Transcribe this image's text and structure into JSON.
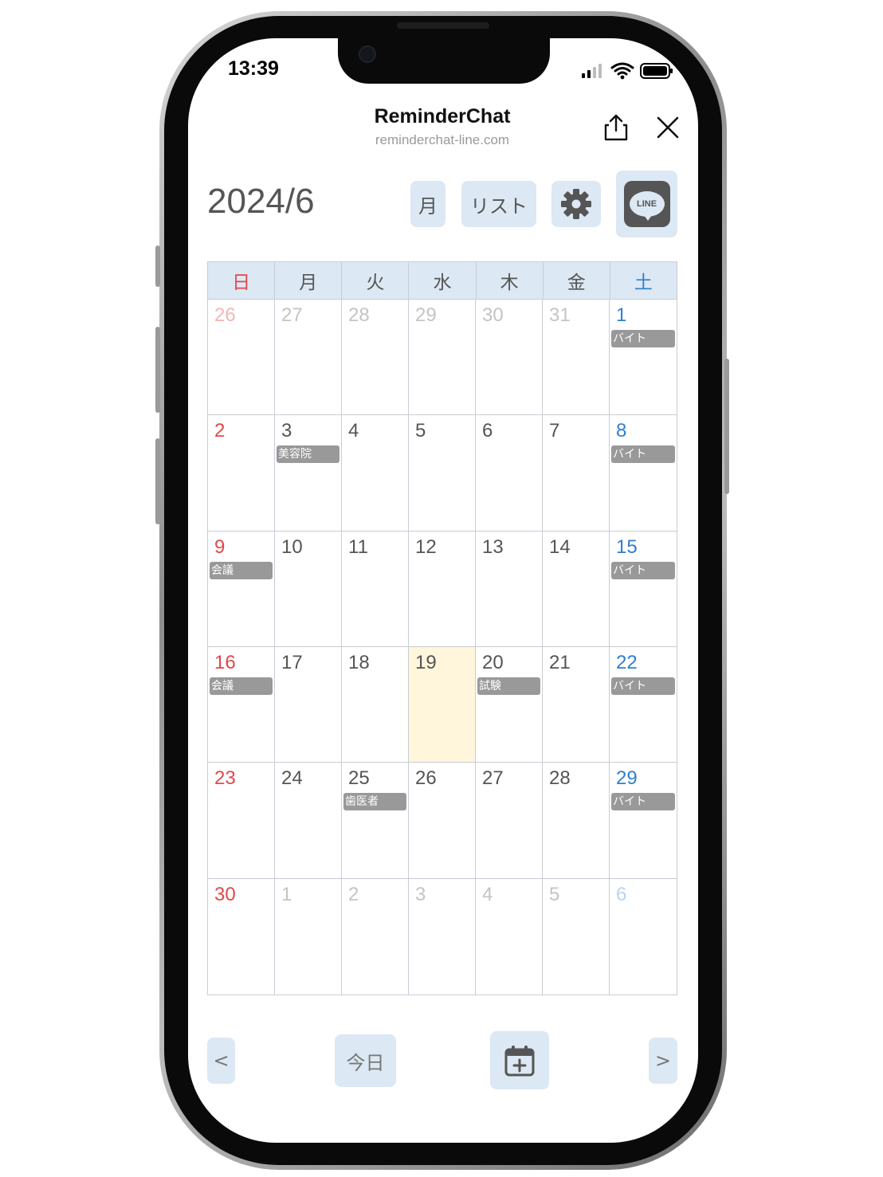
{
  "status_bar": {
    "time": "13:39"
  },
  "browser_header": {
    "title": "ReminderChat",
    "url": "reminderchat-line.com",
    "share_icon": "share-icon",
    "close_icon": "close-icon"
  },
  "toolbar": {
    "month_title": "2024/6",
    "month_view_label": "月",
    "list_view_label": "リスト",
    "settings_icon": "gear-icon",
    "line_label": "LINE"
  },
  "calendar": {
    "weekdays": [
      "日",
      "月",
      "火",
      "水",
      "木",
      "金",
      "土"
    ],
    "weeks": [
      [
        {
          "day": "26",
          "out": true
        },
        {
          "day": "27",
          "out": true
        },
        {
          "day": "28",
          "out": true
        },
        {
          "day": "29",
          "out": true
        },
        {
          "day": "30",
          "out": true
        },
        {
          "day": "31",
          "out": true
        },
        {
          "day": "1",
          "event": "バイト"
        }
      ],
      [
        {
          "day": "2"
        },
        {
          "day": "3",
          "event": "美容院"
        },
        {
          "day": "4"
        },
        {
          "day": "5"
        },
        {
          "day": "6"
        },
        {
          "day": "7"
        },
        {
          "day": "8",
          "event": "バイト"
        }
      ],
      [
        {
          "day": "9",
          "event": "会議"
        },
        {
          "day": "10"
        },
        {
          "day": "11"
        },
        {
          "day": "12"
        },
        {
          "day": "13"
        },
        {
          "day": "14"
        },
        {
          "day": "15",
          "event": "バイト"
        }
      ],
      [
        {
          "day": "16",
          "event": "会議"
        },
        {
          "day": "17"
        },
        {
          "day": "18"
        },
        {
          "day": "19",
          "today": true
        },
        {
          "day": "20",
          "event": "試験"
        },
        {
          "day": "21"
        },
        {
          "day": "22",
          "event": "バイト"
        }
      ],
      [
        {
          "day": "23"
        },
        {
          "day": "24"
        },
        {
          "day": "25",
          "event": "歯医者"
        },
        {
          "day": "26"
        },
        {
          "day": "27"
        },
        {
          "day": "28"
        },
        {
          "day": "29",
          "event": "バイト"
        }
      ],
      [
        {
          "day": "30"
        },
        {
          "day": "1",
          "out": true
        },
        {
          "day": "2",
          "out": true
        },
        {
          "day": "3",
          "out": true
        },
        {
          "day": "4",
          "out": true
        },
        {
          "day": "5",
          "out": true
        },
        {
          "day": "6",
          "out": true
        }
      ]
    ]
  },
  "bottom_bar": {
    "prev_label": "<",
    "today_label": "今日",
    "add_icon": "calendar-add-icon",
    "next_label": ">"
  },
  "colors": {
    "accent_bg": "#dce8f3",
    "sunday": "#e0484b",
    "saturday": "#2f7fd0",
    "today_bg": "#fff6dc",
    "event_bg": "#999999"
  }
}
